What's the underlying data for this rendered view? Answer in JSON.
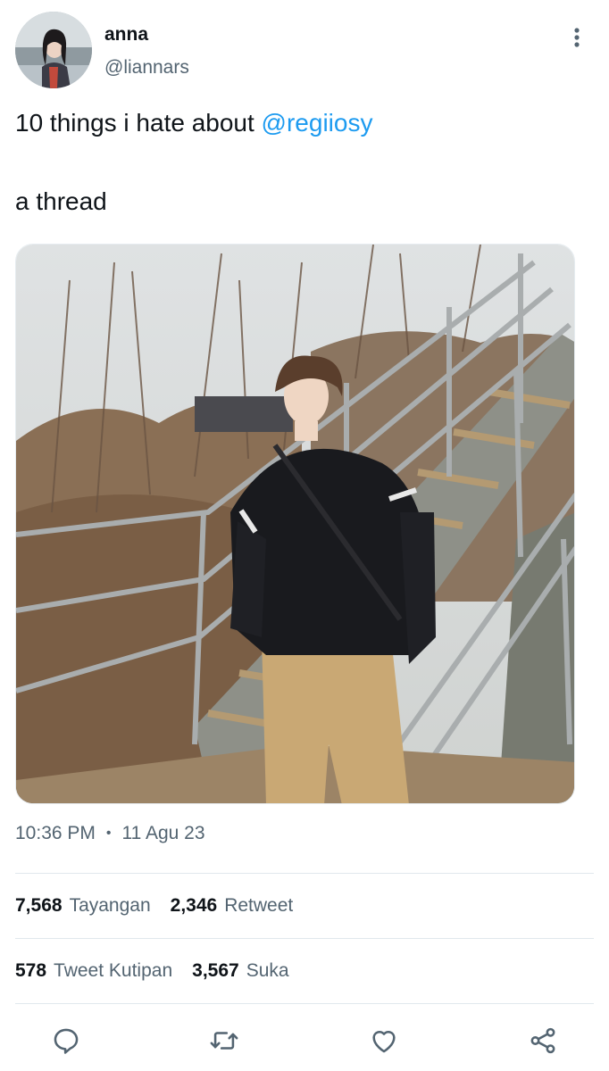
{
  "author": {
    "display_name": "anna",
    "handle": "@liannars",
    "avatar_icon": "profile-photo"
  },
  "tweet": {
    "text_line1_prefix": "10 things i hate about ",
    "mention": "@regiiosy",
    "text_line2": "a thread",
    "media_icon": "photo-person-on-stairs"
  },
  "meta": {
    "time": "10:36 PM",
    "separator": "•",
    "date": "11 Agu 23"
  },
  "stats_row1": [
    {
      "count": "7,568",
      "label": "Tayangan"
    },
    {
      "count": "2,346",
      "label": "Retweet"
    }
  ],
  "stats_row2": [
    {
      "count": "578",
      "label": "Tweet Kutipan"
    },
    {
      "count": "3,567",
      "label": "Suka"
    }
  ],
  "actions": {
    "reply_icon": "reply-icon",
    "retweet_icon": "retweet-icon",
    "like_icon": "like-icon",
    "share_icon": "share-icon"
  },
  "colors": {
    "accent": "#1d9bf0",
    "text": "#0f1419",
    "muted": "#536471",
    "divider": "#e1e8ed"
  }
}
